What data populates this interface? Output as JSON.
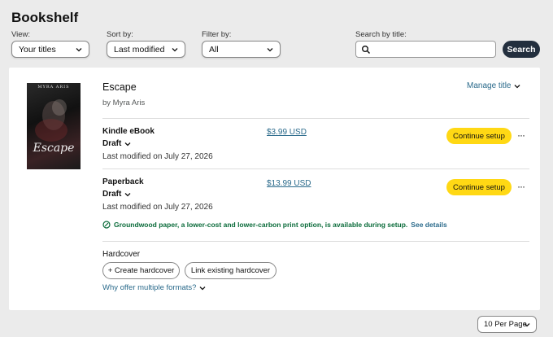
{
  "page": {
    "title": "Bookshelf"
  },
  "controls": {
    "view": {
      "label": "View:",
      "value": "Your titles"
    },
    "sort": {
      "label": "Sort by:",
      "value": "Last modified"
    },
    "filter": {
      "label": "Filter by:",
      "value": "All"
    },
    "search": {
      "label": "Search by title:",
      "value": "",
      "button": "Search"
    }
  },
  "book": {
    "cover": {
      "author": "MYRA ARIS",
      "title": "Escape"
    },
    "title": "Escape",
    "author": "by Myra Aris",
    "manage_label": "Manage title",
    "formats": [
      {
        "name": "Kindle eBook",
        "status": "Draft",
        "modified": "Last modified on July 27, 2026",
        "price": "$3.99 USD",
        "action": "Continue setup",
        "more": "···"
      },
      {
        "name": "Paperback",
        "status": "Draft",
        "modified": "Last modified on July 27, 2026",
        "price": "$13.99 USD",
        "action": "Continue setup",
        "more": "···"
      }
    ],
    "notice": {
      "text": "Groundwood paper, a lower-cost and lower-carbon print option, is available during setup.",
      "link": "See details"
    },
    "hardcover": {
      "name": "Hardcover",
      "create": "+ Create hardcover",
      "link_existing": "Link existing hardcover"
    },
    "why_label": "Why offer multiple formats?"
  },
  "pagination": {
    "per_page": "10 Per Page"
  },
  "icons": {
    "chevron": "chevron-down-icon",
    "search": "search-icon",
    "leaf": "leaf-icon",
    "more": "more-options-icon"
  },
  "colors": {
    "primary_button": "#ffd814",
    "search_button": "#232f3e",
    "link": "#2a6a8b",
    "notice": "#0a6b3a"
  }
}
